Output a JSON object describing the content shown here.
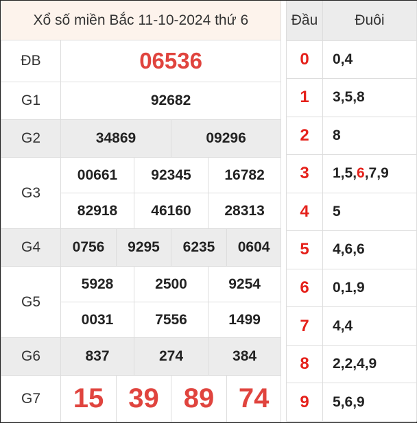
{
  "title": "Xổ số miền Bắc 11-10-2024 thứ 6",
  "prizes": {
    "db": {
      "label": "ĐB",
      "numbers": [
        "06536"
      ]
    },
    "g1": {
      "label": "G1",
      "numbers": [
        "92682"
      ]
    },
    "g2": {
      "label": "G2",
      "numbers": [
        "34869",
        "09296"
      ]
    },
    "g3": {
      "label": "G3",
      "numbers": [
        "00661",
        "92345",
        "16782",
        "82918",
        "46160",
        "28313"
      ]
    },
    "g4": {
      "label": "G4",
      "numbers": [
        "0756",
        "9295",
        "6235",
        "0604"
      ]
    },
    "g5": {
      "label": "G5",
      "numbers": [
        "5928",
        "2500",
        "9254",
        "0031",
        "7556",
        "1499"
      ]
    },
    "g6": {
      "label": "G6",
      "numbers": [
        "837",
        "274",
        "384"
      ]
    },
    "g7": {
      "label": "G7",
      "numbers": [
        "15",
        "39",
        "89",
        "74"
      ]
    }
  },
  "dau_duoi": {
    "header_dau": "Đầu",
    "header_duoi": "Đuôi",
    "rows": [
      {
        "dau": "0",
        "duoi": "0,4"
      },
      {
        "dau": "1",
        "duoi": "3,5,8"
      },
      {
        "dau": "2",
        "duoi": "8"
      },
      {
        "dau": "3",
        "duoi_parts": [
          "1,5,",
          "6",
          ",7,9"
        ]
      },
      {
        "dau": "4",
        "duoi": "5"
      },
      {
        "dau": "5",
        "duoi": "4,6,6"
      },
      {
        "dau": "6",
        "duoi": "0,1,9"
      },
      {
        "dau": "7",
        "duoi": "4,4"
      },
      {
        "dau": "8",
        "duoi": "2,2,4,9"
      },
      {
        "dau": "9",
        "duoi": "5,6,9"
      }
    ]
  },
  "colors": {
    "highlight_red": "#e0443e",
    "title_bg": "#fdf3ec",
    "stripe_bg": "#ececec"
  }
}
